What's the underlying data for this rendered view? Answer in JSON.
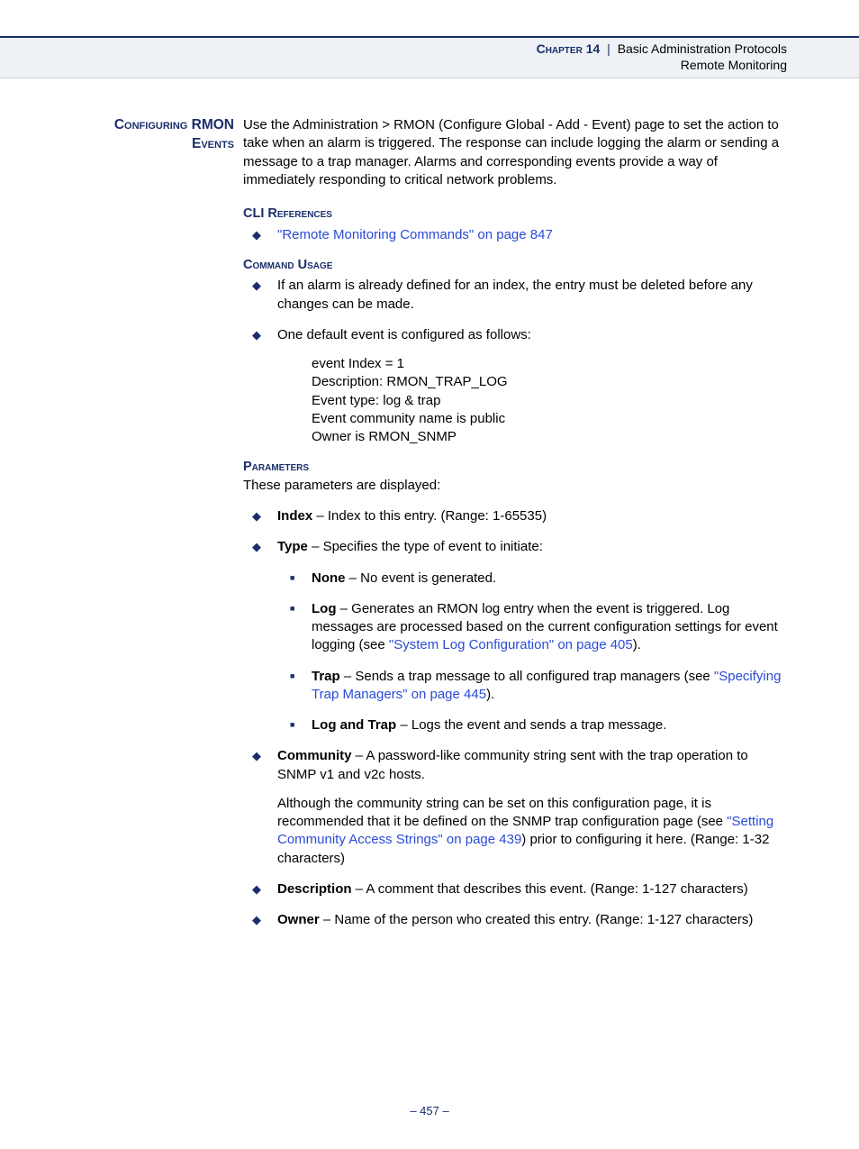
{
  "header": {
    "chapter": "Chapter 14",
    "title": "Basic Administration Protocols",
    "subtitle": "Remote Monitoring"
  },
  "sideHeading": "Configuring RMON Events",
  "introPara": "Use the Administration > RMON (Configure Global - Add - Event) page to set the action to take when an alarm is triggered. The response can include logging the alarm or sending a message to a trap manager. Alarms and corresponding events provide a way of immediately responding to critical network problems.",
  "cliRef": {
    "label": "CLI References",
    "link": "\"Remote Monitoring Commands\" on page 847"
  },
  "cmdUsage": {
    "label": "Command Usage",
    "items": [
      "If an alarm is already defined for an index, the entry must be deleted before any changes can be made.",
      "One default event is configured as follows:"
    ],
    "codeblock": "event Index = 1\n    Description: RMON_TRAP_LOG\n    Event type: log & trap\n    Event community name is public\n    Owner is RMON_SNMP"
  },
  "params": {
    "label": "Parameters",
    "intro": "These parameters are displayed:",
    "index": {
      "name": "Index",
      "desc": " – Index to this entry. (Range: 1-65535)"
    },
    "type": {
      "name": "Type",
      "desc": " – Specifies the type of event to initiate:",
      "sub": {
        "none": {
          "name": "None",
          "desc": " – No event is generated."
        },
        "log": {
          "name": "Log",
          "descPre": " – Generates an RMON log entry when the event is triggered. Log messages are processed based on the current configuration settings for event logging (see ",
          "link": "\"System Log Configuration\" on page 405",
          "descPost": ")."
        },
        "trap": {
          "name": "Trap",
          "descPre": " – Sends a trap message to all configured trap managers (see ",
          "link": "\"Specifying Trap Managers\" on page 445",
          "descPost": ")."
        },
        "logtrap": {
          "name": "Log and Trap",
          "desc": " – Logs the event and sends a trap message."
        }
      }
    },
    "community": {
      "name": "Community",
      "desc": " – A password-like community string sent with the trap operation to SNMP v1 and v2c hosts.",
      "notePre": "Although the community string can be set on this configuration page, it is recommended that it be defined on the SNMP trap configuration page (see ",
      "noteLink": "\"Setting Community Access Strings\" on page 439",
      "notePost": ") prior to configuring it here. (Range: 1-32 characters)"
    },
    "description": {
      "name": "Description",
      "desc": " – A comment that describes this event. (Range: 1-127 characters)"
    },
    "owner": {
      "name": "Owner",
      "desc": " – Name of the person who created this entry. (Range: 1-127 characters)"
    }
  },
  "pageNumber": "–  457  –"
}
